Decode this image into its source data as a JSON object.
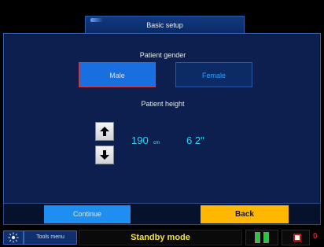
{
  "window": {
    "title": "Basic setup"
  },
  "gender": {
    "label": "Patient gender",
    "options": [
      "Male",
      "Female"
    ],
    "selected": "Male"
  },
  "height": {
    "label": "Patient height",
    "value": "190",
    "unit": "cm",
    "imperial": "6 2\""
  },
  "actions": {
    "continue": "Continue",
    "back": "Back"
  },
  "status": {
    "tools_menu": "Tools menu",
    "mode": "Standby mode",
    "alarm_count": "0"
  },
  "icons": {
    "tools": "sun-icon",
    "up": "arrow-up-icon",
    "down": "arrow-down-icon",
    "battery": "battery-icon",
    "alarm": "alarm-icon"
  },
  "colors": {
    "panel": "#0c1f4e",
    "male_button": "#1a6fe0",
    "female_text": "#2ea3ff",
    "continue_button": "#1e8ef0",
    "back_button": "#ffb700",
    "mode_text": "#f1e53a",
    "height_value": "#2fd3f5"
  }
}
